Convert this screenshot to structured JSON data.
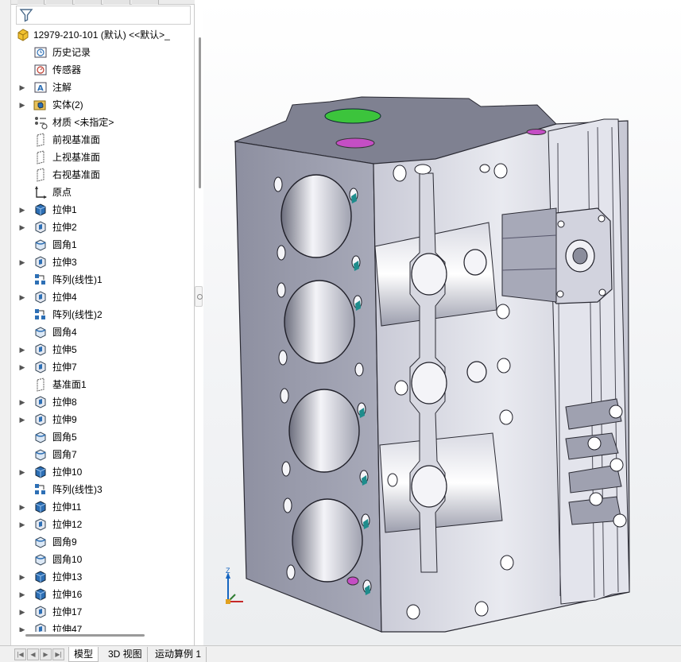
{
  "tree": {
    "root": "12979-210-101 (默认) <<默认>_",
    "items": [
      {
        "label": "历史记录",
        "icon": "history-icon",
        "expandable": false
      },
      {
        "label": "传感器",
        "icon": "sensor-icon",
        "expandable": false
      },
      {
        "label": "注解",
        "icon": "annotation-icon",
        "expandable": true
      },
      {
        "label": "实体(2)",
        "icon": "solid-bodies-icon",
        "expandable": true
      },
      {
        "label": "材质 <未指定>",
        "icon": "material-icon",
        "expandable": false
      },
      {
        "label": "前视基准面",
        "icon": "plane-icon",
        "expandable": false
      },
      {
        "label": "上视基准面",
        "icon": "plane-icon",
        "expandable": false
      },
      {
        "label": "右视基准面",
        "icon": "plane-icon",
        "expandable": false
      },
      {
        "label": "原点",
        "icon": "origin-icon",
        "expandable": false
      },
      {
        "label": "拉伸1",
        "icon": "boss-extrude-icon",
        "expandable": true
      },
      {
        "label": "拉伸2",
        "icon": "cut-extrude-icon",
        "expandable": true
      },
      {
        "label": "圆角1",
        "icon": "fillet-icon",
        "expandable": false
      },
      {
        "label": "拉伸3",
        "icon": "cut-extrude-icon",
        "expandable": true
      },
      {
        "label": "阵列(线性)1",
        "icon": "linear-pattern-icon",
        "expandable": false
      },
      {
        "label": "拉伸4",
        "icon": "cut-extrude-icon",
        "expandable": true
      },
      {
        "label": "阵列(线性)2",
        "icon": "linear-pattern-icon",
        "expandable": false
      },
      {
        "label": "圆角4",
        "icon": "fillet-icon",
        "expandable": false
      },
      {
        "label": "拉伸5",
        "icon": "cut-extrude-icon",
        "expandable": true
      },
      {
        "label": "拉伸7",
        "icon": "cut-extrude-icon",
        "expandable": true
      },
      {
        "label": "基准面1",
        "icon": "plane-icon",
        "expandable": false
      },
      {
        "label": "拉伸8",
        "icon": "cut-extrude-icon",
        "expandable": true
      },
      {
        "label": "拉伸9",
        "icon": "cut-extrude-icon",
        "expandable": true
      },
      {
        "label": "圆角5",
        "icon": "fillet-icon",
        "expandable": false
      },
      {
        "label": "圆角7",
        "icon": "fillet-icon",
        "expandable": false
      },
      {
        "label": "拉伸10",
        "icon": "boss-extrude-icon",
        "expandable": true
      },
      {
        "label": "阵列(线性)3",
        "icon": "linear-pattern-icon",
        "expandable": false
      },
      {
        "label": "拉伸11",
        "icon": "boss-extrude-icon",
        "expandable": true
      },
      {
        "label": "拉伸12",
        "icon": "cut-extrude-icon",
        "expandable": true
      },
      {
        "label": "圆角9",
        "icon": "fillet-icon",
        "expandable": false
      },
      {
        "label": "圆角10",
        "icon": "fillet-icon",
        "expandable": false
      },
      {
        "label": "拉伸13",
        "icon": "boss-extrude-icon",
        "expandable": true
      },
      {
        "label": "拉伸16",
        "icon": "boss-extrude-icon",
        "expandable": true
      },
      {
        "label": "拉伸17",
        "icon": "cut-extrude-icon",
        "expandable": true
      },
      {
        "label": "拉伸47",
        "icon": "cut-extrude-icon",
        "expandable": true
      }
    ]
  },
  "triad": {
    "axis_label": "Z"
  },
  "bottom_tabs": [
    {
      "label": "模型",
      "active": true
    },
    {
      "label": "3D 视图",
      "active": false
    },
    {
      "label": "运动算例 1",
      "active": false
    }
  ],
  "colors": {
    "model_body": "#9a9cab",
    "model_light": "#dcdde6",
    "green_hole": "#2fae2f",
    "magenta_hole": "#c44ec4",
    "teal_accent": "#1e8c8c",
    "icon_blue": "#2d6fb5"
  }
}
